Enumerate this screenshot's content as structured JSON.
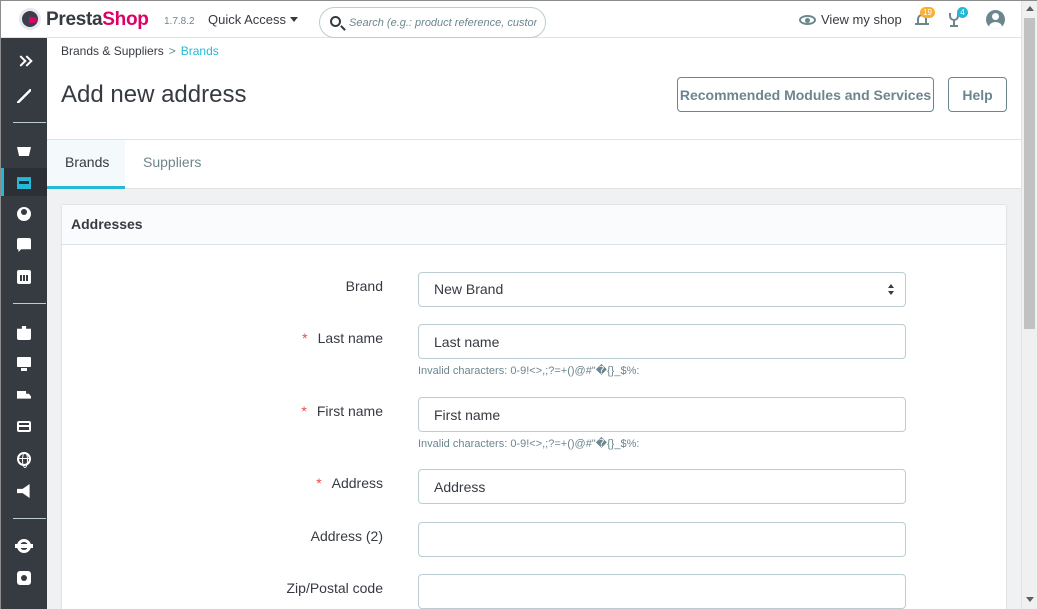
{
  "header": {
    "brand_part1": "Presta",
    "brand_part2": "Shop",
    "version": "1.7.8.2",
    "quick_access": "Quick Access",
    "search_placeholder": "Search (e.g.: product reference, custon",
    "view_shop": "View my shop",
    "orders_badge": "19",
    "customers_badge": "4"
  },
  "sidebar": {
    "items": [
      "collapse-icon",
      "dashboard-icon",
      "orders-icon",
      "catalog-icon",
      "customers-icon",
      "messages-icon",
      "stats-icon",
      "modules-icon",
      "design-icon",
      "shipping-icon",
      "payment-icon",
      "international-icon",
      "marketing-icon",
      "settings-icon",
      "advanced-icon"
    ],
    "active": "catalog-icon",
    "active_color": "#25b9d7"
  },
  "breadcrumb": {
    "parent": "Brands & Suppliers",
    "separator": ">",
    "current": "Brands"
  },
  "page": {
    "title": "Add new address",
    "recommended_button": "Recommended Modules and Services",
    "help_button": "Help"
  },
  "tabs": [
    {
      "label": "Brands",
      "active": true
    },
    {
      "label": "Suppliers",
      "active": false
    }
  ],
  "panel": {
    "title": "Addresses",
    "fields": {
      "brand": {
        "label": "Brand",
        "value": "New Brand"
      },
      "last_name": {
        "label": "Last name",
        "placeholder": "Last name",
        "required_mark": "*",
        "hint": "Invalid characters: 0-9!<>,;?=+()@#\"�{}_$%:"
      },
      "first_name": {
        "label": "First name",
        "placeholder": "First name",
        "required_mark": "*",
        "hint": "Invalid characters: 0-9!<>,;?=+()@#\"�{}_$%:"
      },
      "address": {
        "label": "Address",
        "placeholder": "Address",
        "required_mark": "*"
      },
      "address2": {
        "label": "Address (2)",
        "value": ""
      },
      "zip": {
        "label": "Zip/Postal code",
        "value": ""
      }
    }
  },
  "colors": {
    "accent": "#25b9d7",
    "brand_pink": "#df0067",
    "sidebar_bg": "#363a41",
    "required": "#e84e4e",
    "orders_badge": "#fbaf31"
  }
}
